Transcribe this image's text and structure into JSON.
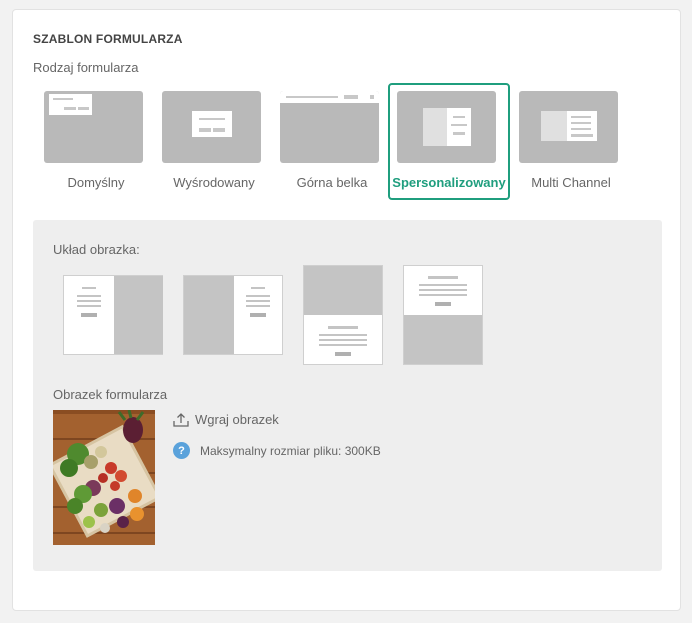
{
  "section": {
    "title": "SZABLON FORMULARZA",
    "type_label": "Rodzaj formularza"
  },
  "form_types": [
    {
      "label": "Domyślny",
      "selected": false
    },
    {
      "label": "Wyśrodowany",
      "selected": false
    },
    {
      "label": "Górna belka",
      "selected": false
    },
    {
      "label": "Spersonalizowany",
      "selected": true
    },
    {
      "label": "Multi Channel",
      "selected": false
    }
  ],
  "image_layout": {
    "label": "Układ obrazka:",
    "options": [
      "image-right",
      "image-left",
      "image-top",
      "image-bottom"
    ]
  },
  "form_image": {
    "label": "Obrazek formularza",
    "upload_label": "Wgraj obrazek",
    "help_icon": "?",
    "max_size_text": "Maksymalny rozmiar pliku: 300KB"
  },
  "colors": {
    "accent": "#1f9e7e",
    "info": "#5aa2db"
  }
}
